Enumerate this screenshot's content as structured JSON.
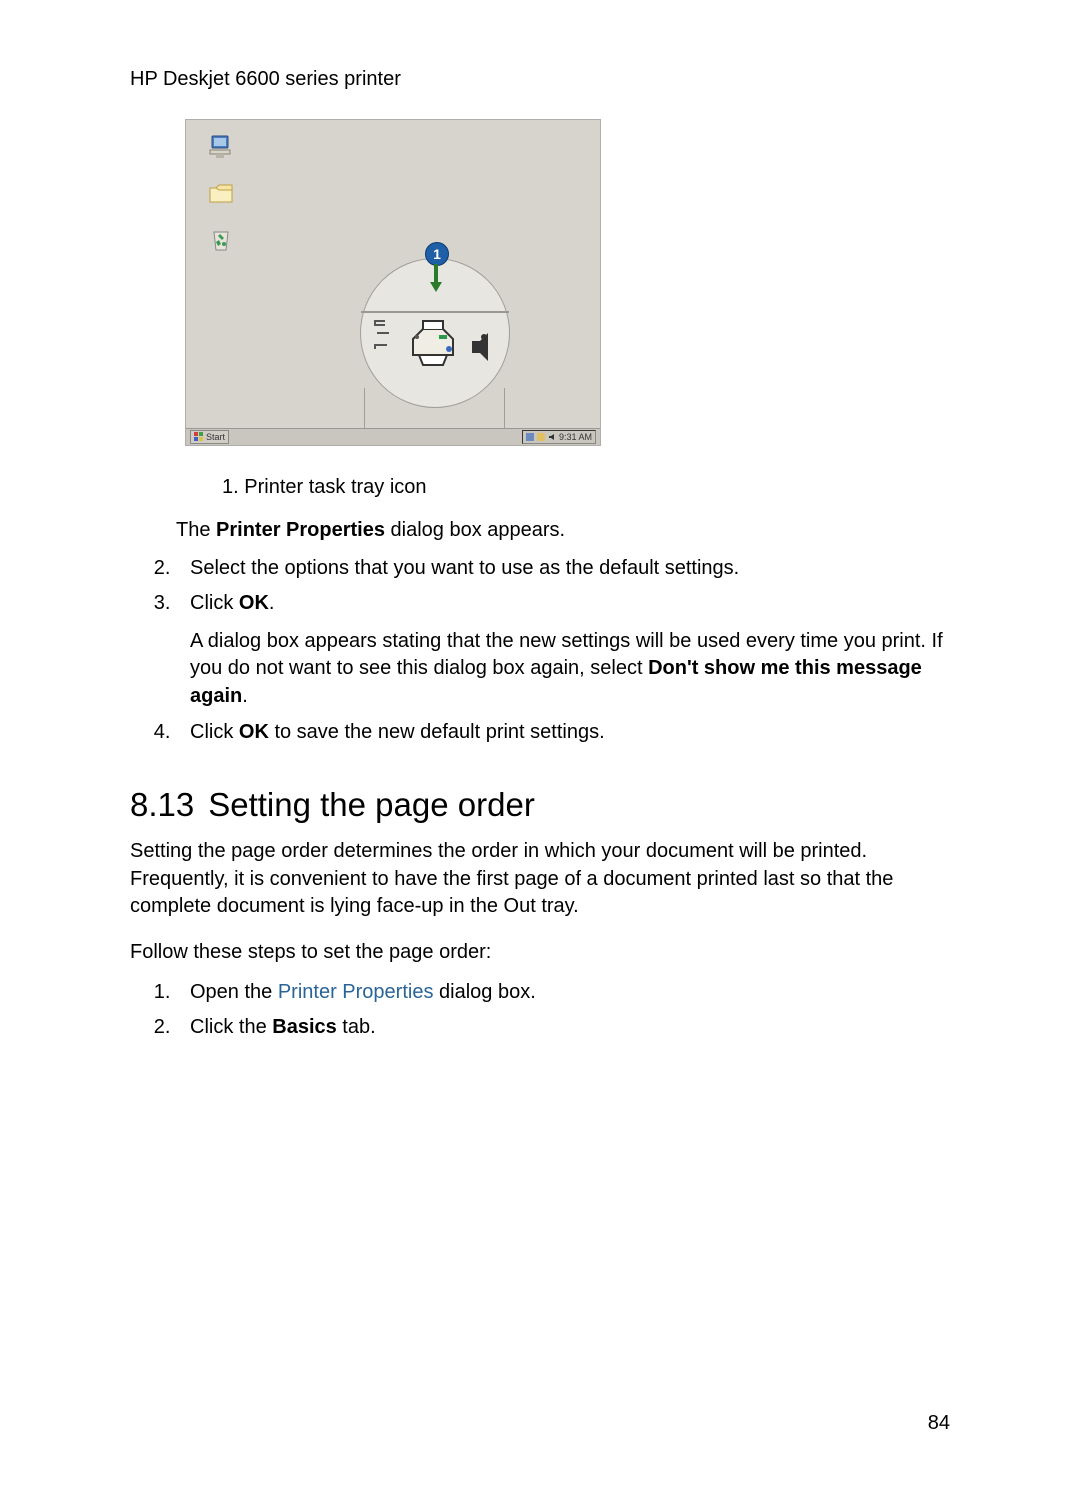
{
  "header": "HP Deskjet 6600 series printer",
  "figure": {
    "callout_number": "1",
    "taskbar_start": "Start",
    "taskbar_time": "9:31 AM"
  },
  "caption": {
    "num": "1.",
    "text": "Printer task tray icon"
  },
  "line_after_figure": {
    "pre": "The ",
    "bold": "Printer Properties",
    "post": " dialog box appears."
  },
  "steps_a": [
    {
      "n": "2.",
      "text": "Select the options that you want to use as the default settings."
    },
    {
      "n": "3.",
      "pre": "Click ",
      "bold": "OK",
      "post": ".",
      "sub_pre": "A dialog box appears stating that the new settings will be used every time you print. If you do not want to see this dialog box again, select ",
      "sub_bold": "Don't show me this message again",
      "sub_post": "."
    },
    {
      "n": "4.",
      "pre": "Click ",
      "bold": "OK",
      "post": " to save the new default print settings."
    }
  ],
  "section": {
    "num": "8.13",
    "title": "Setting the page order"
  },
  "section_para": "Setting the page order determines the order in which your document will be printed. Frequently, it is convenient to have the first page of a document printed last so that the complete document is lying face-up in the Out tray.",
  "section_lead": "Follow these steps to set the page order:",
  "steps_b": [
    {
      "n": "1.",
      "pre": "Open the ",
      "link": "Printer Properties",
      "post": " dialog box."
    },
    {
      "n": "2.",
      "pre": "Click the ",
      "bold": "Basics",
      "post": " tab."
    }
  ],
  "page_number": "84"
}
